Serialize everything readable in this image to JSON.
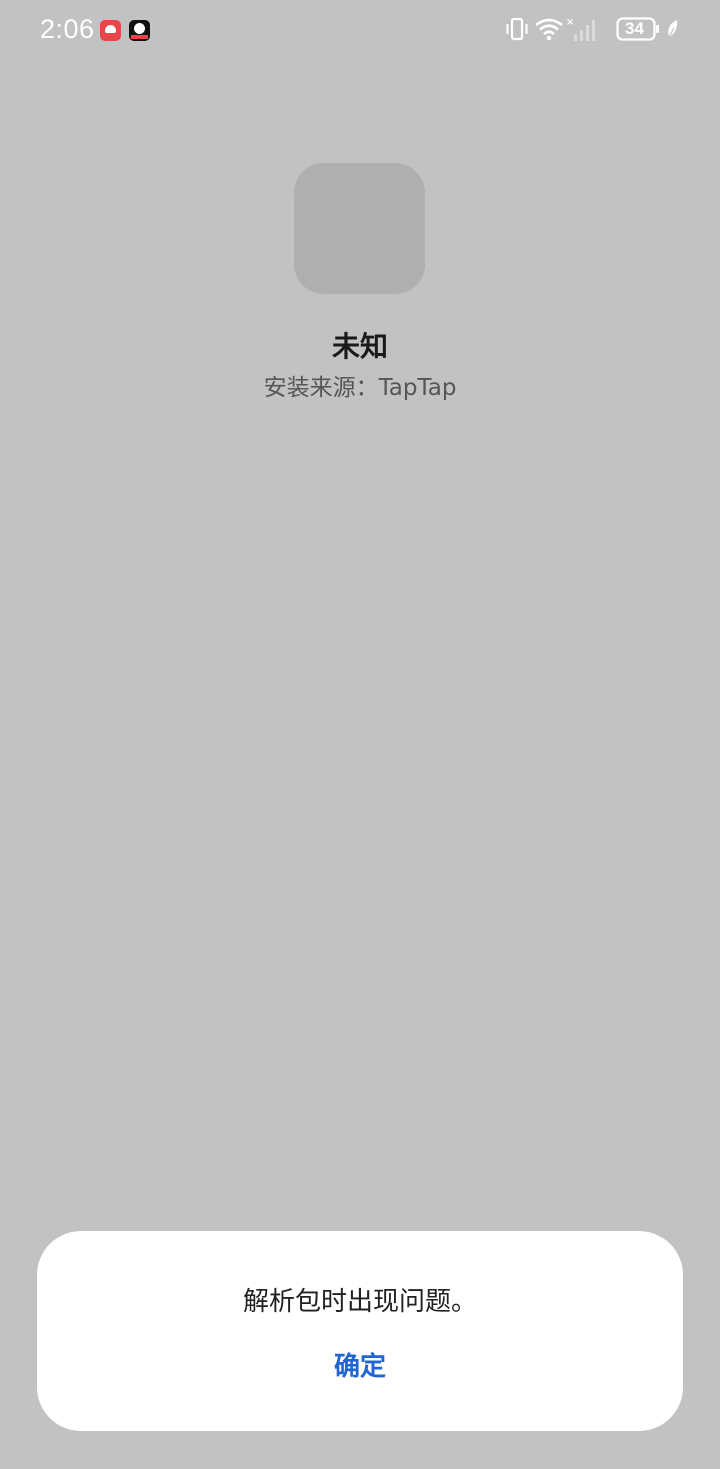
{
  "status_bar": {
    "time": "2:06",
    "battery_level": "34",
    "icons": [
      "huawei-notification-icon",
      "app-notification-icon",
      "vibrate-icon",
      "wifi-icon",
      "signal-icon",
      "battery-icon",
      "leaf-icon"
    ]
  },
  "app": {
    "name": "未知",
    "install_source": "安装来源：TapTap"
  },
  "dialog": {
    "message": "解析包时出现问题。",
    "confirm_label": "确定"
  },
  "colors": {
    "background": "#c1c2c4",
    "accent": "#2166d0",
    "dialog_bg": "#ffffff"
  }
}
